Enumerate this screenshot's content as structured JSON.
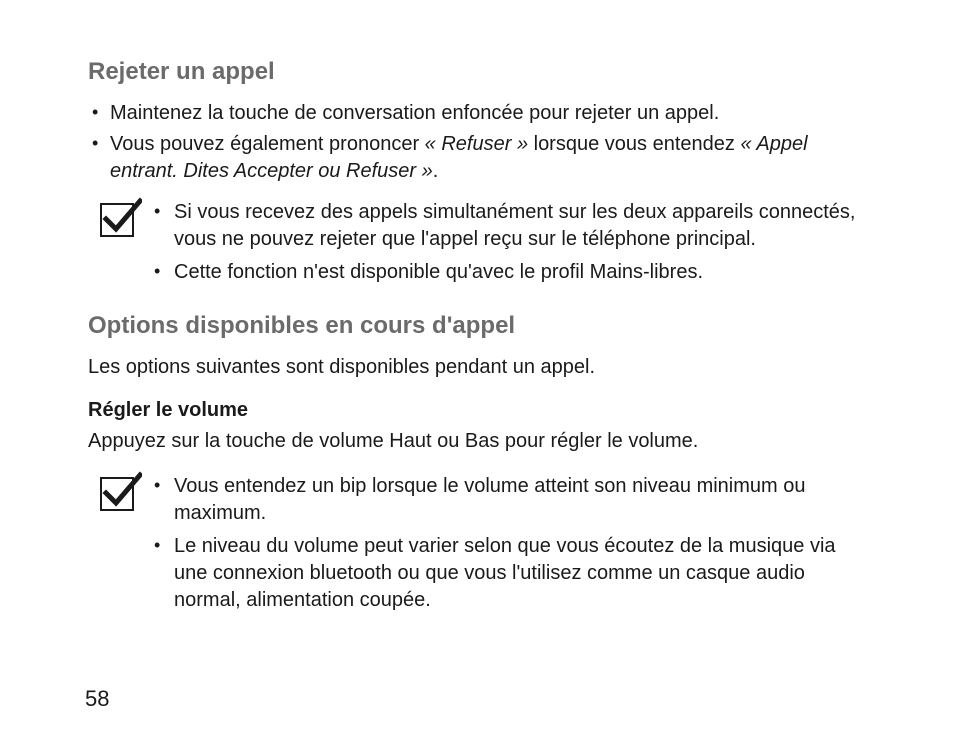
{
  "section1": {
    "heading": "Rejeter un appel",
    "bullets": [
      {
        "text_a": "Maintenez la touche de conversation enfoncée pour rejeter un appel."
      },
      {
        "text_a": "Vous pouvez également prononcer ",
        "ital_a": "« Refuser »",
        "text_b": " lorsque vous entendez ",
        "ital_b": "« Appel entrant. Dites Accepter ou Refuser »",
        "text_c": "."
      }
    ],
    "note_bullets": [
      "Si vous recevez des appels simultanément sur les deux appareils connectés, vous ne pouvez rejeter que l'appel reçu sur le téléphone principal.",
      "Cette fonction n'est disponible qu'avec le profil Mains-libres."
    ]
  },
  "section2": {
    "heading": "Options disponibles en cours d'appel",
    "intro": "Les options suivantes sont disponibles pendant un appel.",
    "subheading": "Régler le volume",
    "body": "Appuyez sur la touche de volume Haut ou Bas pour régler le volume.",
    "note_bullets": [
      "Vous entendez un bip lorsque le volume atteint son niveau minimum ou maximum.",
      "Le niveau du volume peut varier selon que vous écoutez de la musique via une connexion bluetooth ou que vous l'utilisez comme un casque audio normal, alimentation coupée."
    ]
  },
  "page_number": "58"
}
